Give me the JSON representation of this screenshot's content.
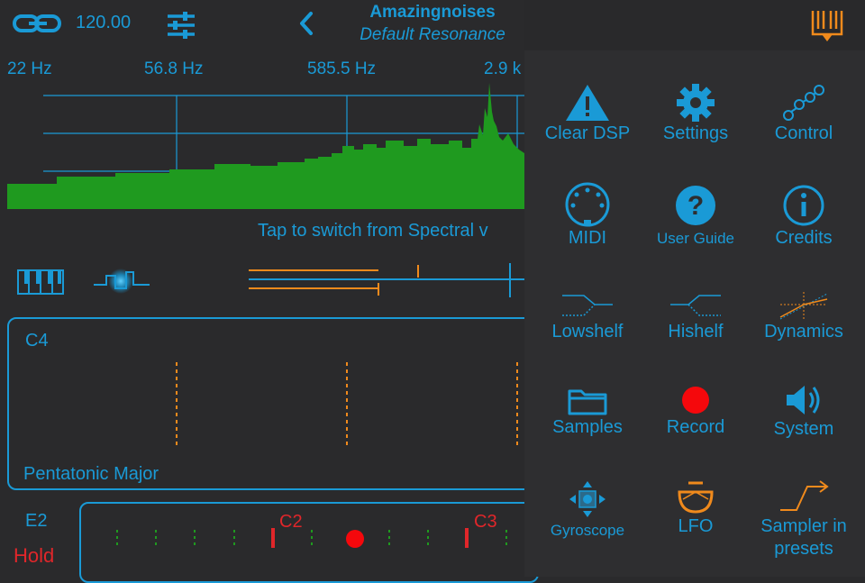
{
  "topbar": {
    "tempo": "120.00",
    "app_title": "Amazingnoises",
    "preset_name": "Default Resonance"
  },
  "spectrum": {
    "freq_labels": [
      "22 Hz",
      "56.8 Hz",
      "585.5 Hz",
      "2.9 k"
    ],
    "switch_hint": "Tap to switch from Spectral v"
  },
  "scale": {
    "root": "C4",
    "name": "Pentatonic Major"
  },
  "keyboard": {
    "note": "E2",
    "hold_label": "Hold",
    "octave_labels": [
      "C2",
      "C3"
    ]
  },
  "menu": {
    "items": [
      {
        "label": "Clear DSP",
        "icon": "warning-icon"
      },
      {
        "label": "Settings",
        "icon": "gear-icon"
      },
      {
        "label": "Control",
        "icon": "nodes-icon"
      },
      {
        "label": "MIDI",
        "icon": "midi-icon"
      },
      {
        "label": "User Guide",
        "icon": "help-icon"
      },
      {
        "label": "Credits",
        "icon": "info-icon"
      },
      {
        "label": "Lowshelf",
        "icon": "lowshelf-icon"
      },
      {
        "label": "Hishelf",
        "icon": "hishelf-icon"
      },
      {
        "label": "Dynamics",
        "icon": "dynamics-icon"
      },
      {
        "label": "Samples",
        "icon": "folder-icon"
      },
      {
        "label": "Record",
        "icon": "record-icon"
      },
      {
        "label": "System",
        "icon": "speaker-icon"
      },
      {
        "label": "Gyroscope",
        "icon": "gyroscope-icon"
      },
      {
        "label": "LFO",
        "icon": "lfo-icon"
      },
      {
        "label": "Sampler in presets",
        "icon": "sampler-icon"
      }
    ]
  },
  "colors": {
    "accent": "#1a9ad6",
    "orange": "#f08a1c",
    "red": "#e0262a",
    "spectrum_green": "#1f9a1f",
    "background": "#2a2a2c"
  }
}
